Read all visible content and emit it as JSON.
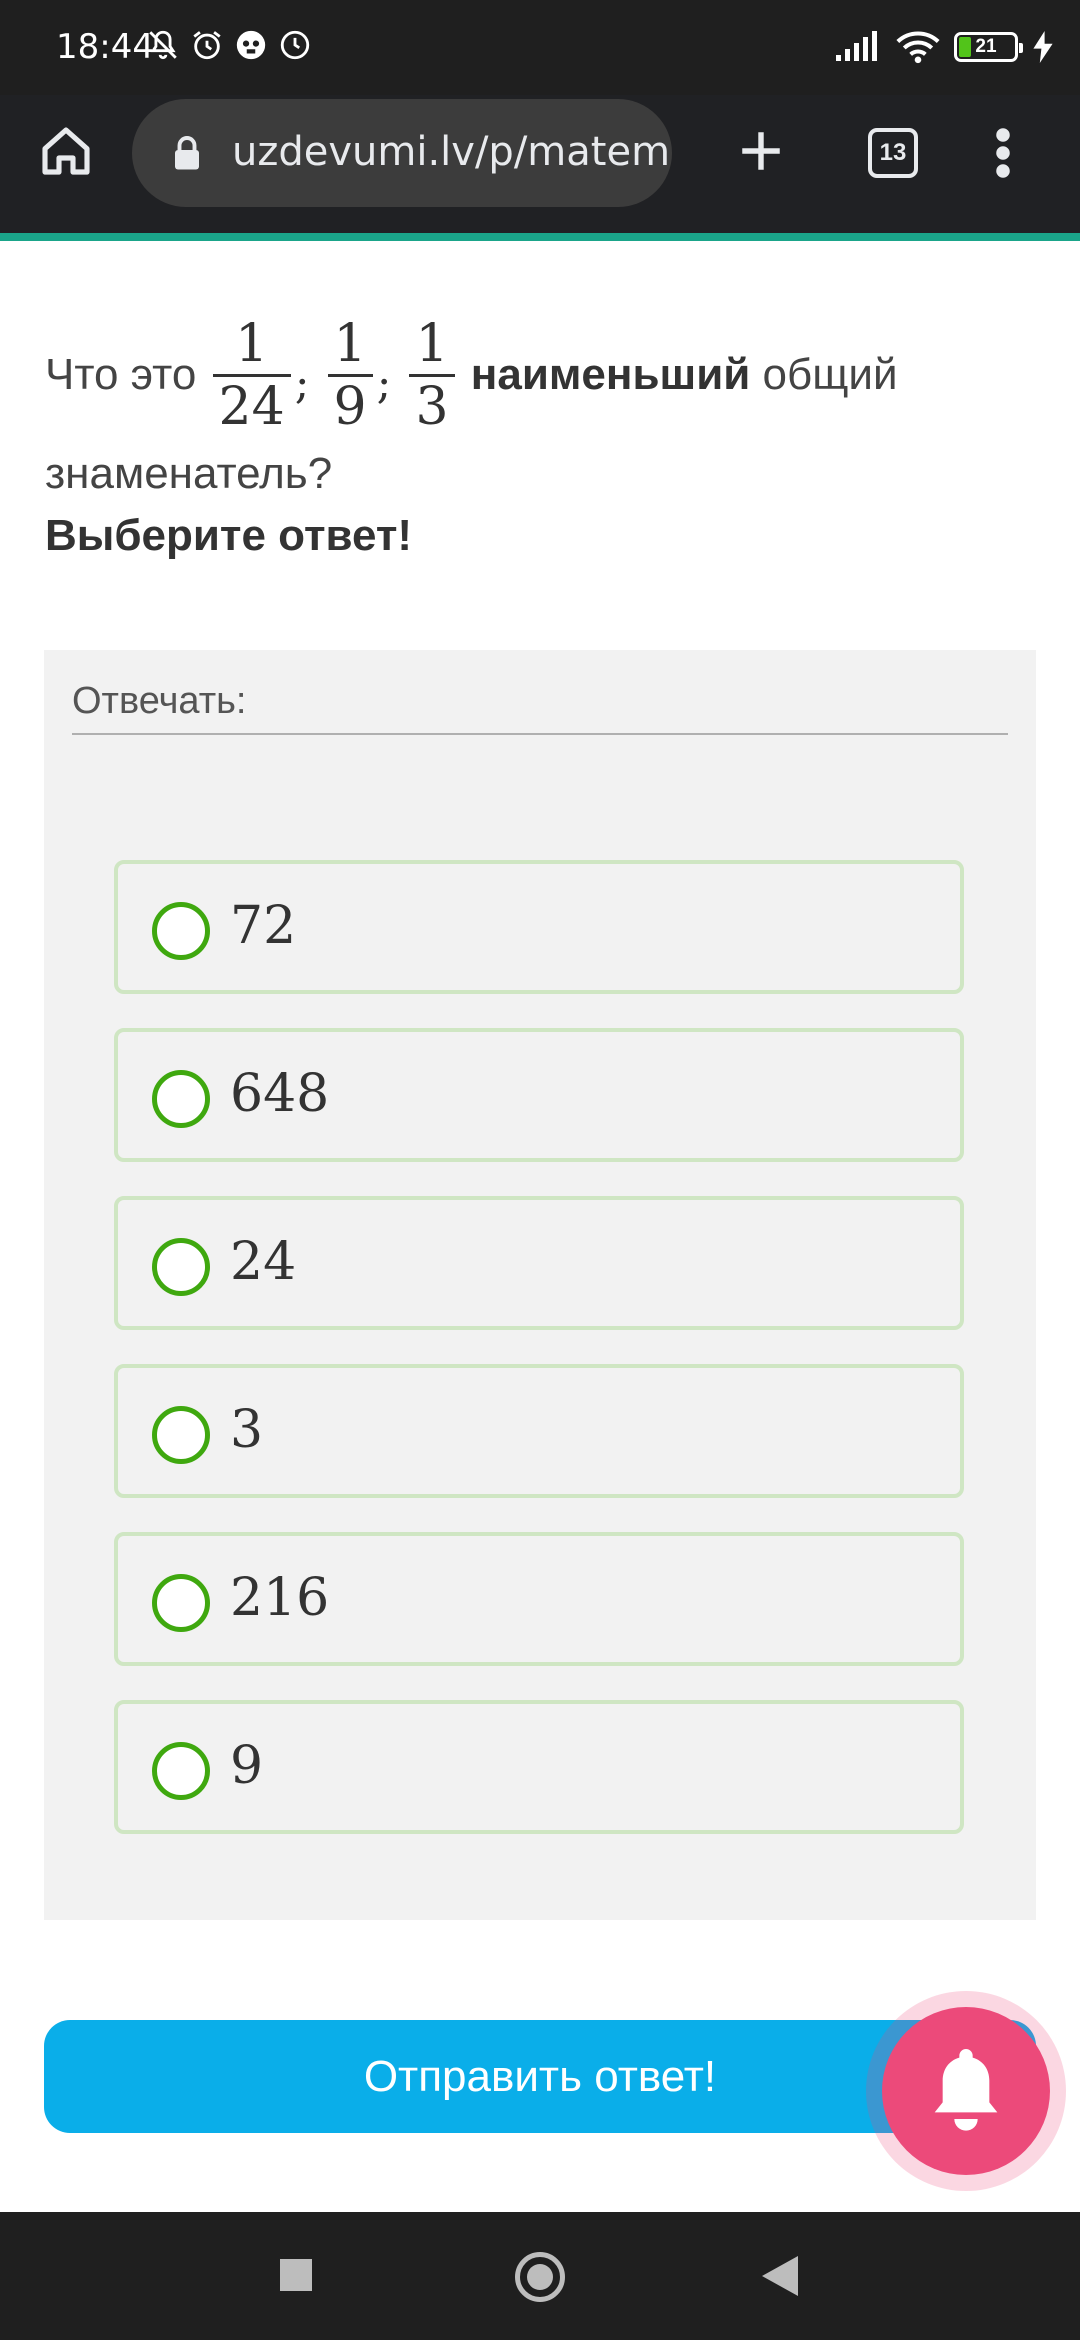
{
  "status_bar": {
    "time": "18:44",
    "battery_level": "21",
    "icons": [
      "mute-icon",
      "alarm-icon",
      "app-notification-icon",
      "clock-icon",
      "signal-icon",
      "wifi-icon",
      "battery-icon",
      "charging-icon"
    ]
  },
  "browser": {
    "url": "uzdevumi.lv/p/matem",
    "tab_count": "13",
    "icons": [
      "home-icon",
      "lock-icon",
      "new-tab-icon",
      "tabs-icon",
      "menu-icon"
    ],
    "accent_color": "#1aa58a"
  },
  "question": {
    "prefix": "Что это",
    "fractions": [
      {
        "numerator": "1",
        "denominator": "24"
      },
      {
        "numerator": "1",
        "denominator": "9"
      },
      {
        "numerator": "1",
        "denominator": "3"
      }
    ],
    "separator": ";",
    "emphasis": "наименьший",
    "suffix_line1": " общий",
    "line2": "знаменатель?",
    "instruction": "Выберите ответ!"
  },
  "answer": {
    "label": "Отвечать:",
    "options": [
      "72",
      "648",
      "24",
      "3",
      "216",
      "9"
    ],
    "radio_color": "#3fa80f"
  },
  "submit": {
    "label": "Отправить ответ!",
    "color": "#0aaee9"
  },
  "notification_button": {
    "icon": "bell-icon",
    "color": "#ec4a7a"
  },
  "nav_bar": {
    "icons": [
      "recents-icon",
      "home-circle-icon",
      "back-icon"
    ]
  }
}
